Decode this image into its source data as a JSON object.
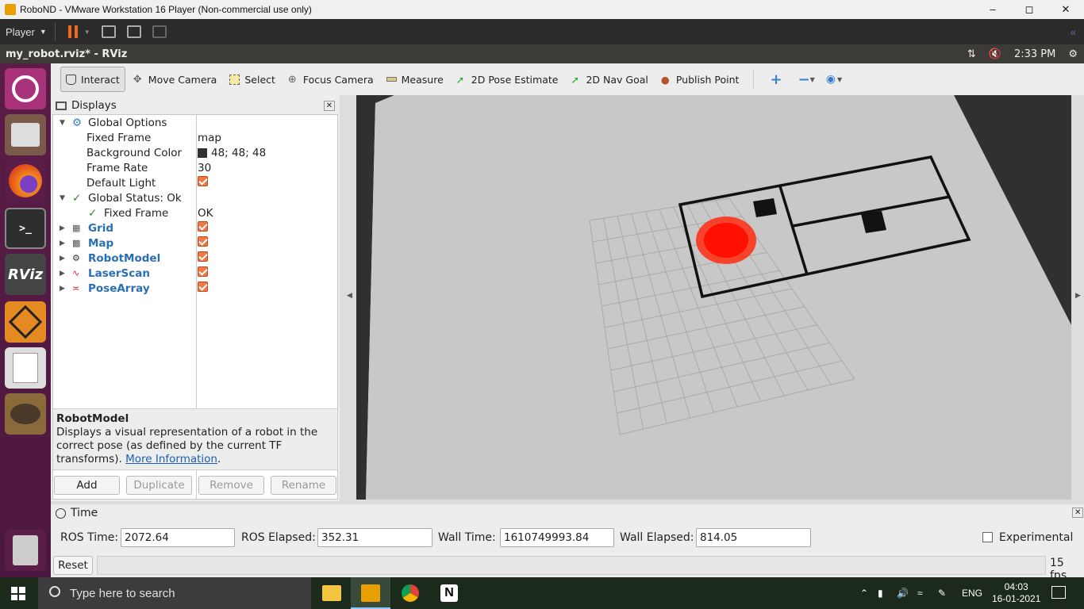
{
  "vm": {
    "title": "RoboND - VMware Workstation 16 Player (Non-commercial use only)",
    "player_label": "Player"
  },
  "ubuntu": {
    "window_title": "my_robot.rviz* - RViz",
    "clock": "2:33 PM",
    "launcher_rviz": "RViz"
  },
  "toolbar": {
    "interact": "Interact",
    "move_camera": "Move Camera",
    "select": "Select",
    "focus_camera": "Focus Camera",
    "measure": "Measure",
    "pose_estimate": "2D Pose Estimate",
    "nav_goal": "2D Nav Goal",
    "publish_point": "Publish Point"
  },
  "displays": {
    "title": "Displays",
    "global_options": "Global Options",
    "fixed_frame_label": "Fixed Frame",
    "fixed_frame_value": "map",
    "bg_color_label": "Background Color",
    "bg_color_value": "48; 48; 48",
    "frame_rate_label": "Frame Rate",
    "frame_rate_value": "30",
    "default_light_label": "Default Light",
    "global_status": "Global Status: Ok",
    "status_fixed_frame": "Fixed Frame",
    "status_fixed_frame_value": "OK",
    "items": [
      {
        "label": "Grid",
        "checked": true
      },
      {
        "label": "Map",
        "checked": true
      },
      {
        "label": "RobotModel",
        "checked": true
      },
      {
        "label": "LaserScan",
        "checked": true
      },
      {
        "label": "PoseArray",
        "checked": true
      }
    ],
    "desc_title": "RobotModel",
    "desc_text": "Displays a visual representation of a robot in the correct pose (as defined by the current TF transforms).",
    "desc_link": "More Information",
    "buttons": {
      "add": "Add",
      "duplicate": "Duplicate",
      "remove": "Remove",
      "rename": "Rename"
    }
  },
  "time": {
    "title": "Time",
    "ros_time_label": "ROS Time:",
    "ros_time": "2072.64",
    "ros_elapsed_label": "ROS Elapsed:",
    "ros_elapsed": "352.31",
    "wall_time_label": "Wall Time:",
    "wall_time": "1610749993.84",
    "wall_elapsed_label": "Wall Elapsed:",
    "wall_elapsed": "814.05",
    "experimental": "Experimental",
    "reset": "Reset",
    "fps": "15 fps"
  },
  "taskbar": {
    "search_placeholder": "Type here to search",
    "lang": "ENG",
    "time": "04:03",
    "date": "16-01-2021"
  },
  "colors": {
    "accent": "#f07746",
    "link": "#2b6fb3",
    "launcher": "#5a1d47"
  }
}
